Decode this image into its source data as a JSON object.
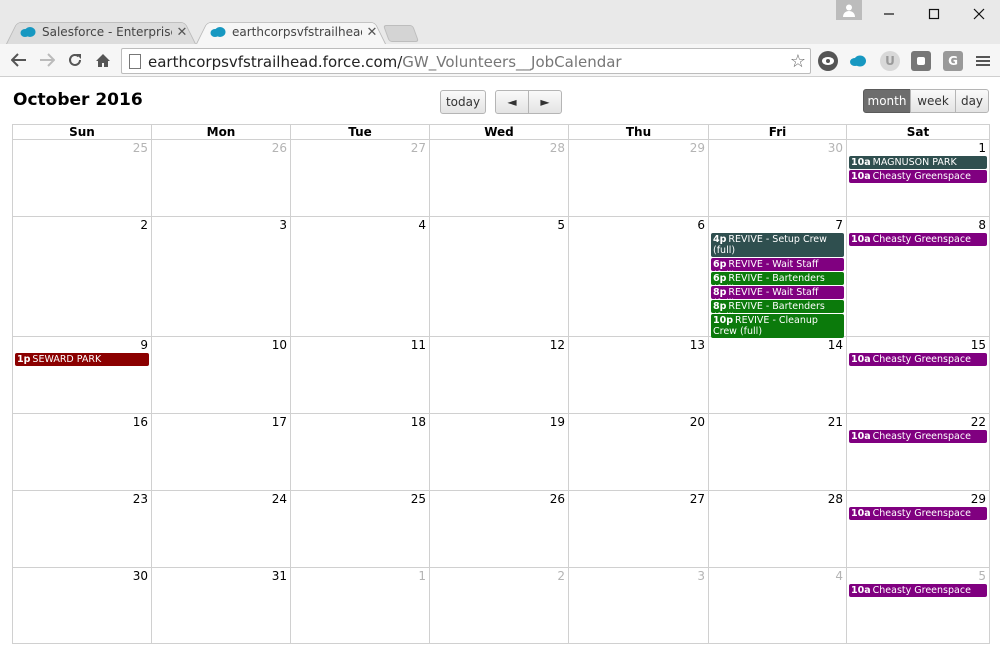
{
  "browser": {
    "tabs": [
      {
        "label": "Salesforce - Enterprise Edi"
      },
      {
        "label": "earthcorpsvfstrailhead.forc"
      }
    ],
    "url_host": "earthcorpsvfstrailhead.force.com/",
    "url_path": "GW_Volunteers__JobCalendar",
    "accent_color": "#1798c1"
  },
  "calendar": {
    "title": "October 2016",
    "buttons": {
      "today": "today",
      "prev": "◄",
      "next": "►",
      "month": "month",
      "week": "week",
      "day": "day"
    },
    "dow": [
      "Sun",
      "Mon",
      "Tue",
      "Wed",
      "Thu",
      "Fri",
      "Sat"
    ],
    "weeks": [
      [
        {
          "num": "25",
          "other": true,
          "events": []
        },
        {
          "num": "26",
          "other": true,
          "events": []
        },
        {
          "num": "27",
          "other": true,
          "events": []
        },
        {
          "num": "28",
          "other": true,
          "events": []
        },
        {
          "num": "29",
          "other": true,
          "events": []
        },
        {
          "num": "30",
          "other": true,
          "events": []
        },
        {
          "num": "1",
          "other": false,
          "events": [
            {
              "time": "10a",
              "title": "MAGNUSON PARK",
              "color": "dark"
            },
            {
              "time": "10a",
              "title": "Cheasty Greenspace",
              "color": "purple"
            }
          ]
        }
      ],
      [
        {
          "num": "2",
          "other": false,
          "events": []
        },
        {
          "num": "3",
          "other": false,
          "events": []
        },
        {
          "num": "4",
          "other": false,
          "events": []
        },
        {
          "num": "5",
          "other": false,
          "events": []
        },
        {
          "num": "6",
          "other": false,
          "events": []
        },
        {
          "num": "7",
          "other": false,
          "events": [
            {
              "time": "4p",
              "title": "REVIVE - Setup Crew (full)",
              "color": "dark",
              "lines": 2
            },
            {
              "time": "6p",
              "title": "REVIVE - Wait Staff (full)",
              "color": "purple"
            },
            {
              "time": "6p",
              "title": "REVIVE - Bartenders (full)",
              "color": "green"
            },
            {
              "time": "8p",
              "title": "REVIVE - Wait Staff (full)",
              "color": "purple"
            },
            {
              "time": "8p",
              "title": "REVIVE - Bartenders (full)",
              "color": "green"
            },
            {
              "time": "10p",
              "title": "REVIVE - Cleanup Crew (full)",
              "color": "green",
              "lines": 2
            }
          ]
        },
        {
          "num": "8",
          "other": false,
          "events": [
            {
              "time": "10a",
              "title": "Cheasty Greenspace",
              "color": "purple"
            }
          ]
        }
      ],
      [
        {
          "num": "9",
          "other": false,
          "events": [
            {
              "time": "1p",
              "title": "SEWARD PARK",
              "color": "red"
            }
          ]
        },
        {
          "num": "10",
          "other": false,
          "events": []
        },
        {
          "num": "11",
          "other": false,
          "events": []
        },
        {
          "num": "12",
          "other": false,
          "events": []
        },
        {
          "num": "13",
          "other": false,
          "events": []
        },
        {
          "num": "14",
          "other": false,
          "events": []
        },
        {
          "num": "15",
          "other": false,
          "events": [
            {
              "time": "10a",
              "title": "Cheasty Greenspace",
              "color": "purple"
            }
          ]
        }
      ],
      [
        {
          "num": "16",
          "other": false,
          "events": []
        },
        {
          "num": "17",
          "other": false,
          "events": []
        },
        {
          "num": "18",
          "other": false,
          "events": []
        },
        {
          "num": "19",
          "other": false,
          "events": []
        },
        {
          "num": "20",
          "other": false,
          "events": []
        },
        {
          "num": "21",
          "other": false,
          "events": []
        },
        {
          "num": "22",
          "other": false,
          "events": [
            {
              "time": "10a",
              "title": "Cheasty Greenspace",
              "color": "purple"
            }
          ]
        }
      ],
      [
        {
          "num": "23",
          "other": false,
          "events": []
        },
        {
          "num": "24",
          "other": false,
          "events": []
        },
        {
          "num": "25",
          "other": false,
          "events": []
        },
        {
          "num": "26",
          "other": false,
          "events": []
        },
        {
          "num": "27",
          "other": false,
          "events": []
        },
        {
          "num": "28",
          "other": false,
          "events": []
        },
        {
          "num": "29",
          "other": false,
          "events": [
            {
              "time": "10a",
              "title": "Cheasty Greenspace",
              "color": "purple"
            }
          ]
        }
      ],
      [
        {
          "num": "30",
          "other": false,
          "events": []
        },
        {
          "num": "31",
          "other": false,
          "events": []
        },
        {
          "num": "1",
          "other": true,
          "events": []
        },
        {
          "num": "2",
          "other": true,
          "events": []
        },
        {
          "num": "3",
          "other": true,
          "events": []
        },
        {
          "num": "4",
          "other": true,
          "events": []
        },
        {
          "num": "5",
          "other": true,
          "events": [
            {
              "time": "10a",
              "title": "Cheasty Greenspace",
              "color": "purple"
            }
          ]
        }
      ]
    ]
  }
}
